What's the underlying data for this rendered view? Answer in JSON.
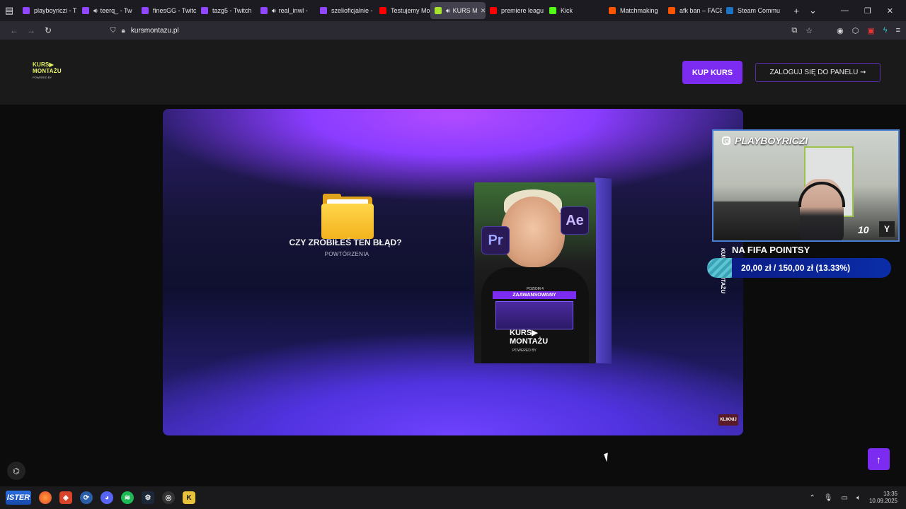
{
  "browser": {
    "tabs": [
      {
        "label": "playboyriczi - T",
        "favicon_color": "#9146ff",
        "icon": "twitch-icon",
        "active": false
      },
      {
        "label": "teerq_ - Tw",
        "favicon_color": "#9146ff",
        "icon": "twitch-icon",
        "active": false,
        "muted": true
      },
      {
        "label": "finesGG - Twitc",
        "favicon_color": "#9146ff",
        "icon": "twitch-icon",
        "active": false
      },
      {
        "label": "tazg5 - Twitch",
        "favicon_color": "#9146ff",
        "icon": "twitch-icon",
        "active": false
      },
      {
        "label": "real_inwl - ",
        "favicon_color": "#9146ff",
        "icon": "twitch-icon",
        "active": false,
        "muted": true
      },
      {
        "label": "szelioficjalnie - ",
        "favicon_color": "#9146ff",
        "icon": "twitch-icon",
        "active": false
      },
      {
        "label": "Testujemy Mor",
        "favicon_color": "#ff0000",
        "icon": "youtube-icon",
        "active": false
      },
      {
        "label": "KURS M",
        "favicon_color": "#a6e22e",
        "icon": "play-icon",
        "active": true,
        "audio": true
      },
      {
        "label": "premiere leagu",
        "favicon_color": "#ff0000",
        "icon": "youtube-icon",
        "active": false
      },
      {
        "label": "Kick",
        "favicon_color": "#53fc18",
        "icon": "kick-icon",
        "active": false
      },
      {
        "label": "Matchmaking",
        "favicon_color": "#ff5500",
        "icon": "faceit-icon",
        "active": false
      },
      {
        "label": "afk ban – FACE",
        "favicon_color": "#ff5500",
        "icon": "faceit-icon",
        "active": false
      },
      {
        "label": "Steam Commu",
        "favicon_color": "#1b75c4",
        "icon": "steam-icon",
        "active": false
      }
    ],
    "url": "kursmontazu.pl"
  },
  "site": {
    "logo_line1": "KURS▶",
    "logo_line2": "MONTAŻU",
    "logo_line3": "POWERED BY ",
    "buy_button": "KUP KURS",
    "login_button": "ZALOGUJ SIĘ DO PANELU ➞"
  },
  "video": {
    "question": "CZY ZROBIŁEŚ TEN BŁĄD?",
    "subtitle": "POWTÓRZENIA",
    "pr_badge": "Pr",
    "ae_badge": "Ae",
    "level_small": "POZIOM 4",
    "level": "ZAAWANSOWANY",
    "box_logo1": "KURS▶",
    "box_logo2": "MONTAŻU",
    "box_powered": "POWERED BY ",
    "box_side": "KURS MONTAŻU",
    "kliknij": "KLIKNIJ"
  },
  "stream_overlay": {
    "cam_title": "PLAYBOYRICZI",
    "cam_number": "10",
    "cam_logo": "Y",
    "goal_title": "NA FIFA POINTSY",
    "goal_text": "20,00 zł  /  150,00 zł (13.33%)",
    "goal_progress": 0.1333
  },
  "taskbar": {
    "start_label": "ISTER",
    "time": "13:35",
    "date": "10.09.2025"
  },
  "colors": {
    "accent": "#7b2cf0",
    "logo_green": "#e8f56a"
  }
}
